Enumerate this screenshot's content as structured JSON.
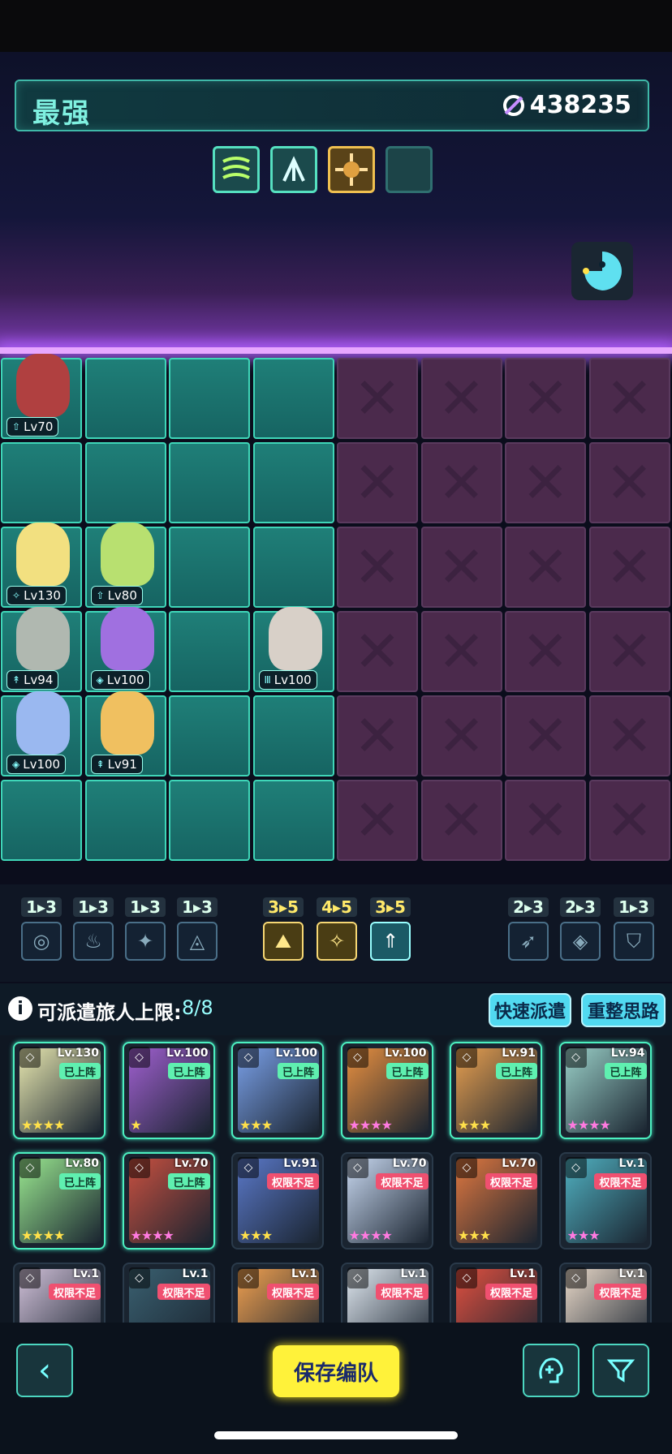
{
  "header": {
    "team_title": "最强",
    "power_icon": "power-icon",
    "power": "438235"
  },
  "bonus_slots": [
    {
      "name": "bonus-slot-1",
      "icon": "wave-emblem-icon"
    },
    {
      "name": "bonus-slot-2",
      "icon": "fountain-emblem-icon"
    },
    {
      "name": "bonus-slot-3",
      "icon": "crosshair-emblem-icon"
    },
    {
      "name": "bonus-slot-4",
      "icon": "empty-slot"
    }
  ],
  "board_heroes": [
    {
      "level": "Lv70",
      "cls": "⇧"
    },
    {
      "level": "Lv130",
      "cls": "✧"
    },
    {
      "level": "Lv80",
      "cls": "⇧"
    },
    {
      "level": "Lv94",
      "cls": "↟"
    },
    {
      "level": "Lv100",
      "cls": "◈"
    },
    {
      "level": "Lv100",
      "cls": "Ⅲ"
    },
    {
      "level": "Lv100",
      "cls": "◈"
    },
    {
      "level": "Lv91",
      "cls": "⇞"
    }
  ],
  "synergies": [
    {
      "count": "1▸3",
      "icon": "spiral-class-icon",
      "glyph": "◎"
    },
    {
      "count": "1▸3",
      "icon": "flame-class-icon",
      "glyph": "♨"
    },
    {
      "count": "1▸3",
      "icon": "shuriken-class-icon",
      "glyph": "✦"
    },
    {
      "count": "1▸3",
      "icon": "arrowhead-class-icon",
      "glyph": "◬"
    },
    {
      "count": "3▸5",
      "icon": "mountain-class-icon",
      "glyph": "⛰"
    },
    {
      "count": "4▸5",
      "icon": "star-class-icon",
      "glyph": "✧"
    },
    {
      "count": "3▸5",
      "icon": "up-arrow-class-icon",
      "glyph": "⇑"
    },
    {
      "count": "2▸3",
      "icon": "bow-class-icon",
      "glyph": "➶"
    },
    {
      "count": "2▸3",
      "icon": "diamond-class-icon",
      "glyph": "◈"
    },
    {
      "count": "1▸3",
      "icon": "shield-class-icon",
      "glyph": "⛉"
    }
  ],
  "info": {
    "label": "可派遣旅人上限:",
    "count": "8/8"
  },
  "buttons": {
    "quick_dispatch": "快速派遣",
    "reset_thoughts": "重整思路",
    "save_team": "保存编队"
  },
  "roster": [
    {
      "level": "Lv.130",
      "status": "已上阵",
      "stars": "★★★★",
      "deployed": true
    },
    {
      "level": "Lv.100",
      "status": "已上阵",
      "stars": "★",
      "deployed": true
    },
    {
      "level": "Lv.100",
      "status": "已上阵",
      "stars": "★★★",
      "deployed": true
    },
    {
      "level": "Lv.100",
      "status": "已上阵",
      "stars": "★★★★",
      "deployed": true
    },
    {
      "level": "Lv.91",
      "status": "已上阵",
      "stars": "★★★",
      "deployed": true
    },
    {
      "level": "Lv.94",
      "status": "已上阵",
      "stars": "★★★★",
      "deployed": true
    },
    {
      "level": "Lv.80",
      "status": "已上阵",
      "stars": "★★★★",
      "deployed": true
    },
    {
      "level": "Lv.70",
      "status": "已上阵",
      "stars": "★★★★",
      "deployed": true
    },
    {
      "level": "Lv.91",
      "status": "权限不足",
      "stars": "★★★",
      "deployed": false
    },
    {
      "level": "Lv.70",
      "status": "权限不足",
      "stars": "★★★★",
      "deployed": false
    },
    {
      "level": "Lv.70",
      "status": "权限不足",
      "stars": "★★★",
      "deployed": false
    },
    {
      "level": "Lv.1",
      "status": "权限不足",
      "stars": "★★★",
      "deployed": false
    },
    {
      "level": "Lv.1",
      "status": "权限不足",
      "stars": "",
      "deployed": false
    },
    {
      "level": "Lv.1",
      "status": "权限不足",
      "stars": "",
      "deployed": false
    },
    {
      "level": "Lv.1",
      "status": "权限不足",
      "stars": "",
      "deployed": false
    },
    {
      "level": "Lv.1",
      "status": "权限不足",
      "stars": "",
      "deployed": false
    },
    {
      "level": "Lv.1",
      "status": "权限不足",
      "stars": "",
      "deployed": false
    },
    {
      "level": "Lv.1",
      "status": "权限不足",
      "stars": "",
      "deployed": false
    }
  ],
  "colors": {
    "accent": "#3fd6b8",
    "enemy": "#4b2a4c",
    "save": "#fff23a",
    "warn": "#f05070"
  }
}
